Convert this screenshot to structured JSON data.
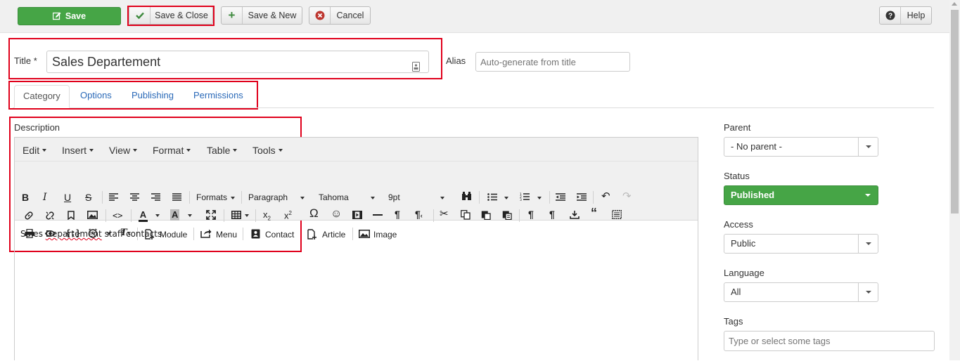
{
  "toolbar": {
    "save_label": "Save",
    "save_close_label": "Save & Close",
    "save_new_label": "Save & New",
    "cancel_label": "Cancel",
    "help_label": "Help"
  },
  "title_field": {
    "label": "Title *",
    "value": "Sales Departement"
  },
  "alias_field": {
    "label": "Alias",
    "placeholder": "Auto-generate from title"
  },
  "tabs": [
    {
      "label": "Category",
      "active": true
    },
    {
      "label": "Options"
    },
    {
      "label": "Publishing"
    },
    {
      "label": "Permissions"
    }
  ],
  "description": {
    "label": "Description",
    "menubar": [
      "Edit",
      "Insert",
      "View",
      "Format",
      "Table",
      "Tools"
    ],
    "formats_label": "Formats",
    "block_format": "Paragraph",
    "font_family": "Tahoma",
    "font_size": "9pt",
    "row3_buttons": {
      "module": "Module",
      "menu": "Menu",
      "contact": "Contact",
      "article": "Article",
      "image": "Image"
    },
    "content_prefix": "Sales ",
    "content_misspelled": "Departement",
    "content_suffix": " staff contacts."
  },
  "sidebar": {
    "parent_label": "Parent",
    "parent_value": "- No parent -",
    "status_label": "Status",
    "status_value": "Published",
    "access_label": "Access",
    "access_value": "Public",
    "language_label": "Language",
    "language_value": "All",
    "tags_label": "Tags",
    "tags_placeholder": "Type or select some tags"
  },
  "colors": {
    "accent_green": "#46a546",
    "highlight_red": "#e0001b",
    "link_blue": "#2a69b8"
  }
}
